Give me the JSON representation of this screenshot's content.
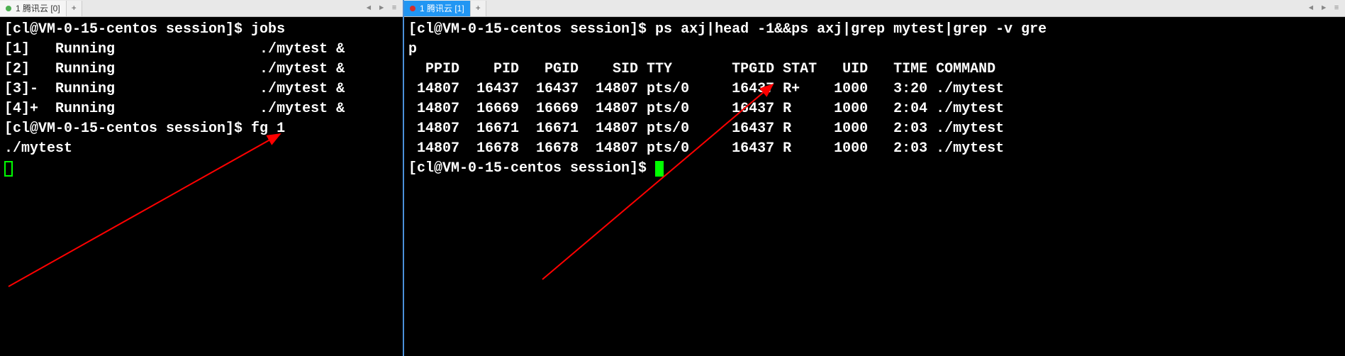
{
  "left_pane": {
    "tab": {
      "label": "1 腾讯云 [0]"
    },
    "add_label": "+",
    "terminal": {
      "lines": [
        "[cl@VM-0-15-centos session]$ jobs",
        "[1]   Running                 ./mytest &",
        "[2]   Running                 ./mytest &",
        "[3]-  Running                 ./mytest &",
        "[4]+  Running                 ./mytest &",
        "[cl@VM-0-15-centos session]$ fg 1",
        "./mytest"
      ]
    }
  },
  "right_pane": {
    "tab": {
      "label": "1 腾讯云 [1]"
    },
    "add_label": "+",
    "terminal": {
      "lines": [
        "[cl@VM-0-15-centos session]$ ps axj|head -1&&ps axj|grep mytest|grep -v gre",
        "p",
        "  PPID    PID   PGID    SID TTY       TPGID STAT   UID   TIME COMMAND",
        " 14807  16437  16437  14807 pts/0     16437 R+    1000   3:20 ./mytest",
        " 14807  16669  16669  14807 pts/0     16437 R     1000   2:04 ./mytest",
        " 14807  16671  16671  14807 pts/0     16437 R     1000   2:03 ./mytest",
        " 14807  16678  16678  14807 pts/0     16437 R     1000   2:03 ./mytest",
        "[cl@VM-0-15-centos session]$ "
      ]
    }
  },
  "nav": {
    "left": "◄",
    "right": "►",
    "menu": "≡"
  }
}
